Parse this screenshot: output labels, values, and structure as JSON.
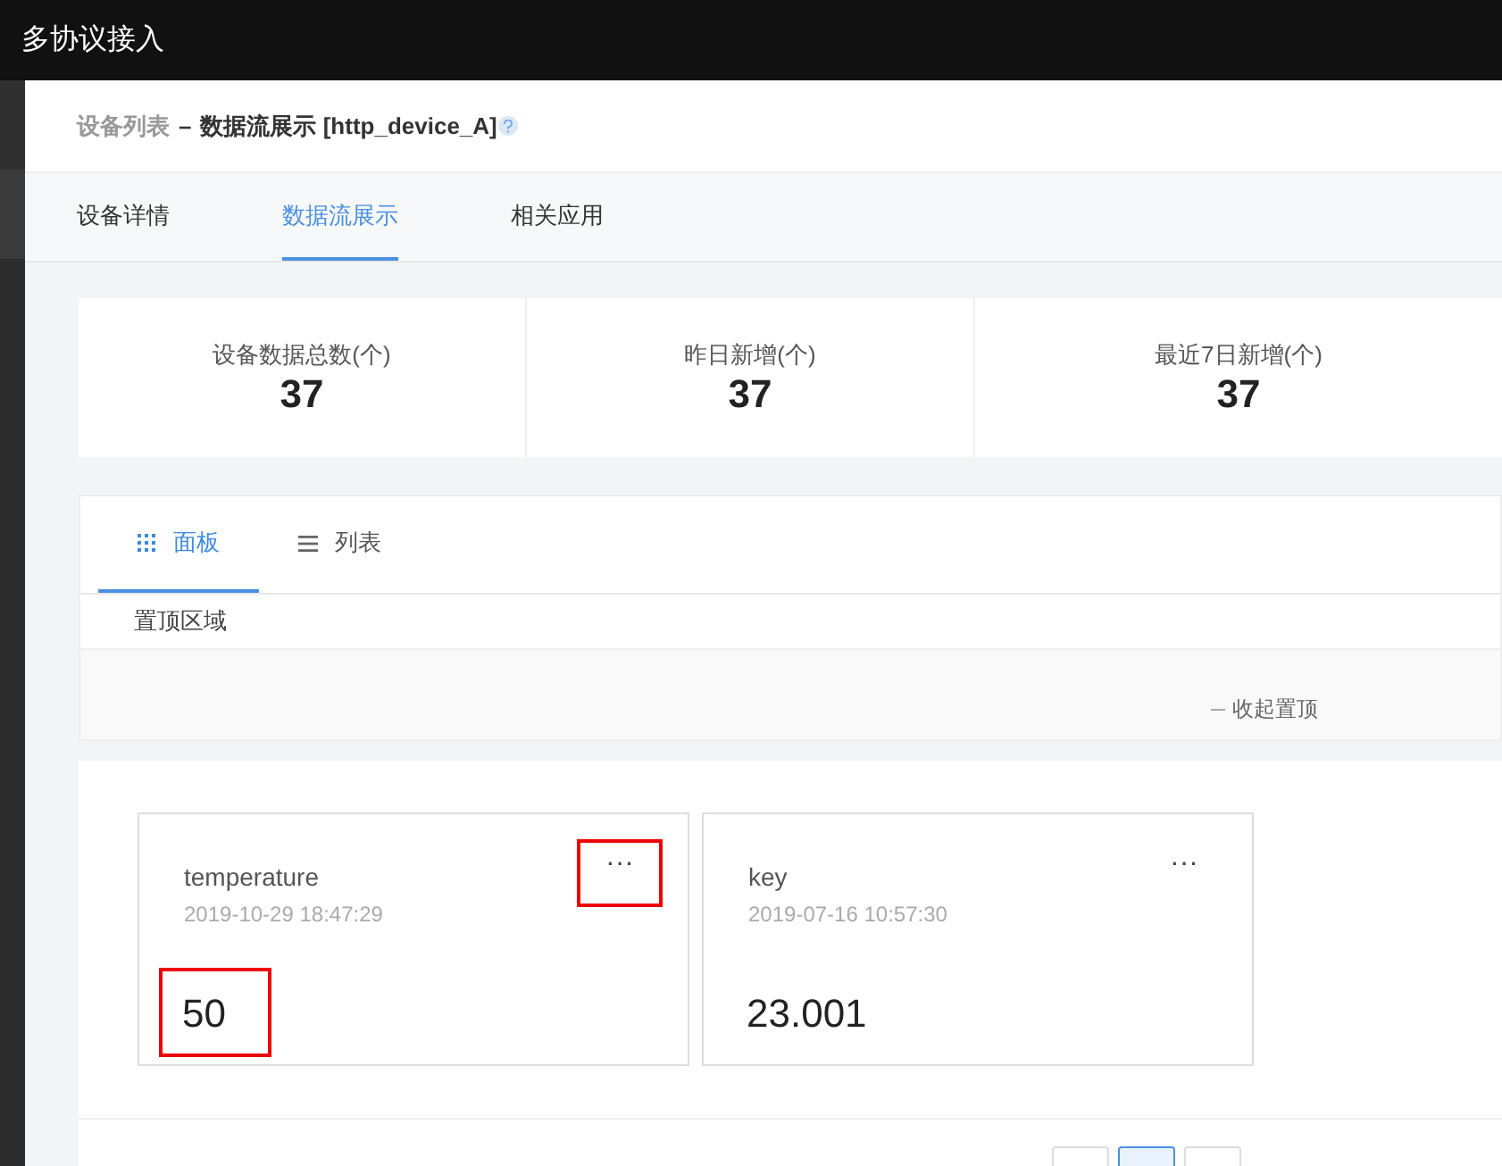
{
  "app_title": "多协议接入",
  "breadcrumb": {
    "parent": "设备列表",
    "separator": "–",
    "current": "数据流展示 [http_device_A]"
  },
  "tabs": [
    {
      "label": "设备详情",
      "selected": false
    },
    {
      "label": "数据流展示",
      "selected": true
    },
    {
      "label": "相关应用",
      "selected": false
    }
  ],
  "stats": [
    {
      "label": "设备数据总数(个)",
      "value": "37"
    },
    {
      "label": "昨日新增(个)",
      "value": "37"
    },
    {
      "label": "最近7日新增(个)",
      "value": "37"
    }
  ],
  "view_tabs": [
    {
      "label": "面板",
      "kind": "grid",
      "selected": true
    },
    {
      "label": "列表",
      "kind": "list",
      "selected": false
    }
  ],
  "pinned": {
    "title": "置顶区域",
    "collapse": "收起置顶"
  },
  "cards": [
    {
      "name": "temperature",
      "time": "2019-10-29 18:47:29",
      "value": "50",
      "menu": "···",
      "menu_highlighted": true,
      "value_highlighted": true
    },
    {
      "name": "key",
      "time": "2019-07-16 10:57:30",
      "value": "23.001",
      "menu": "···",
      "menu_highlighted": false,
      "value_highlighted": false
    }
  ],
  "pagination": [
    {
      "selected": false
    },
    {
      "selected": true
    },
    {
      "selected": false
    }
  ]
}
